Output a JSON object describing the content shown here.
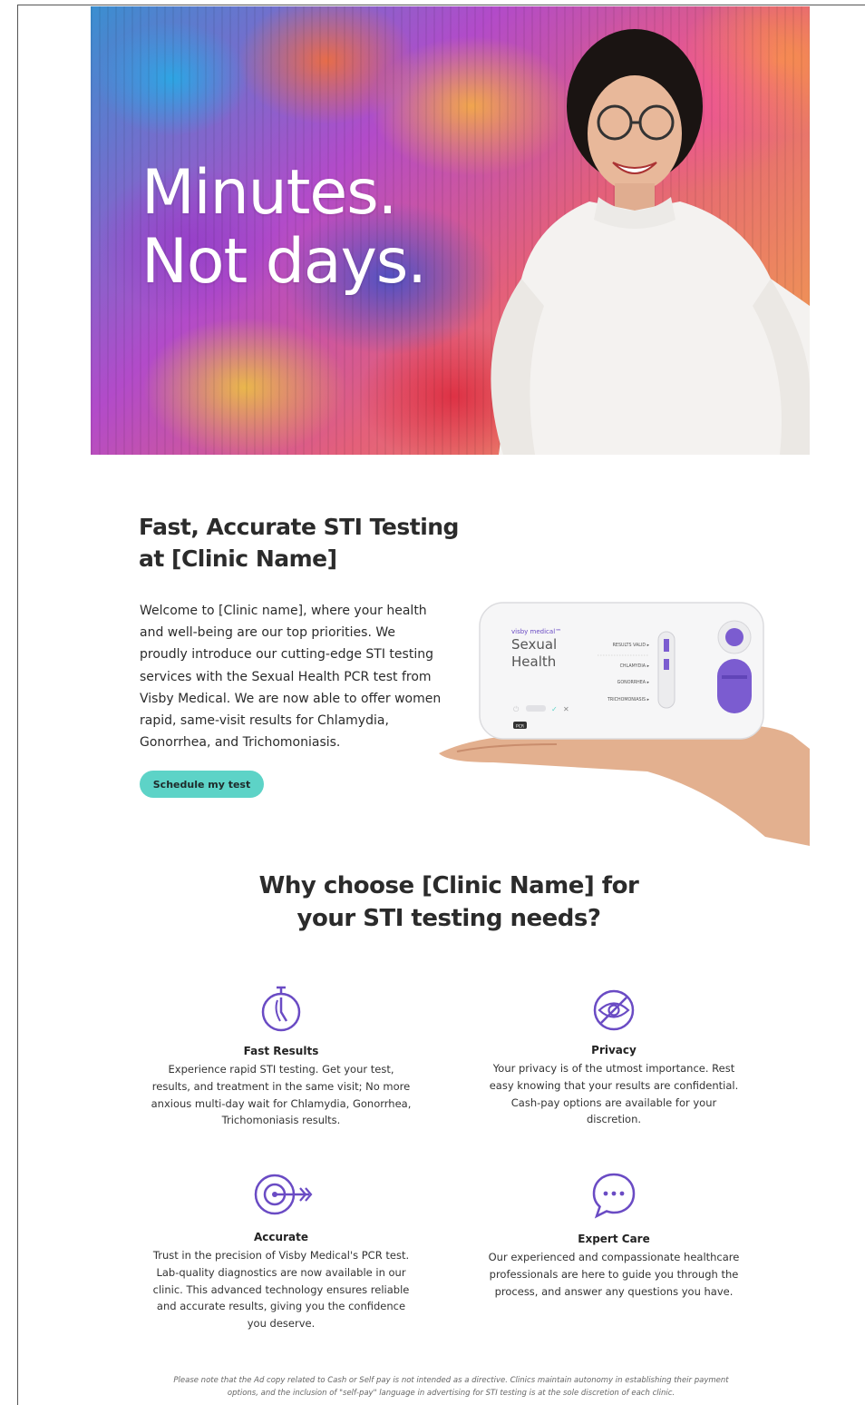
{
  "hero": {
    "line1": "Minutes.",
    "line2": "Not days."
  },
  "intro": {
    "heading_line1": "Fast, Accurate STI Testing",
    "heading_line2": "at [Clinic Name]",
    "body": "Welcome to [Clinic name], where your health and well-being are our top priorities. We proudly introduce our cutting-edge STI testing services with the Sexual Health PCR test from Visby Medical. We are now able to offer women rapid, same-visit results for Chlamydia, Gonorrhea, and Trichomoniasis.",
    "cta_label": "Schedule my test"
  },
  "device": {
    "brand": "visby medical™",
    "title_line1": "Sexual",
    "title_line2": "Health",
    "results_valid": "RESULTS VALID ▸",
    "chlamydia": "CHLAMYDIA ▸",
    "gonorrhea": "GONORRHEA ▸",
    "trichomoniasis": "TRICHOMONIASIS ▸",
    "badge": "PCR"
  },
  "why": {
    "heading_line1": "Why choose [Clinic Name] for",
    "heading_line2": "your STI testing needs?"
  },
  "features": [
    {
      "icon": "stopwatch-icon",
      "title": "Fast Results",
      "text": "Experience rapid STI testing. Get your test, results, and treatment in the same visit; No more anxious multi-day wait for Chlamydia, Gonorrhea, Trichomoniasis results."
    },
    {
      "icon": "eye-slash-icon",
      "title": "Privacy",
      "text": "Your privacy is of the utmost importance. Rest easy knowing that your results are confidential. Cash-pay options are available for your discretion."
    },
    {
      "icon": "target-arrow-icon",
      "title": "Accurate",
      "text": "Trust in the precision of Visby Medical's PCR test. Lab-quality diagnostics are now available in our clinic. This advanced technology ensures reliable and accurate results, giving you the confidence you deserve."
    },
    {
      "icon": "chat-bubble-icon",
      "title": "Expert Care",
      "text": "Our experienced and compassionate healthcare professionals are here to guide you through the process, and answer any questions you have."
    }
  ],
  "disclaimer": "Please note that the Ad copy related to Cash or Self pay is not intended as a directive. Clinics maintain autonomy in establishing their payment options, and the inclusion of \"self-pay\" language in advertising for STI testing is at the sole discretion of each clinic.",
  "colors": {
    "accent_teal": "#5dd3c7",
    "icon_purple": "#6a4bc4",
    "heading": "#2b2b2b"
  }
}
